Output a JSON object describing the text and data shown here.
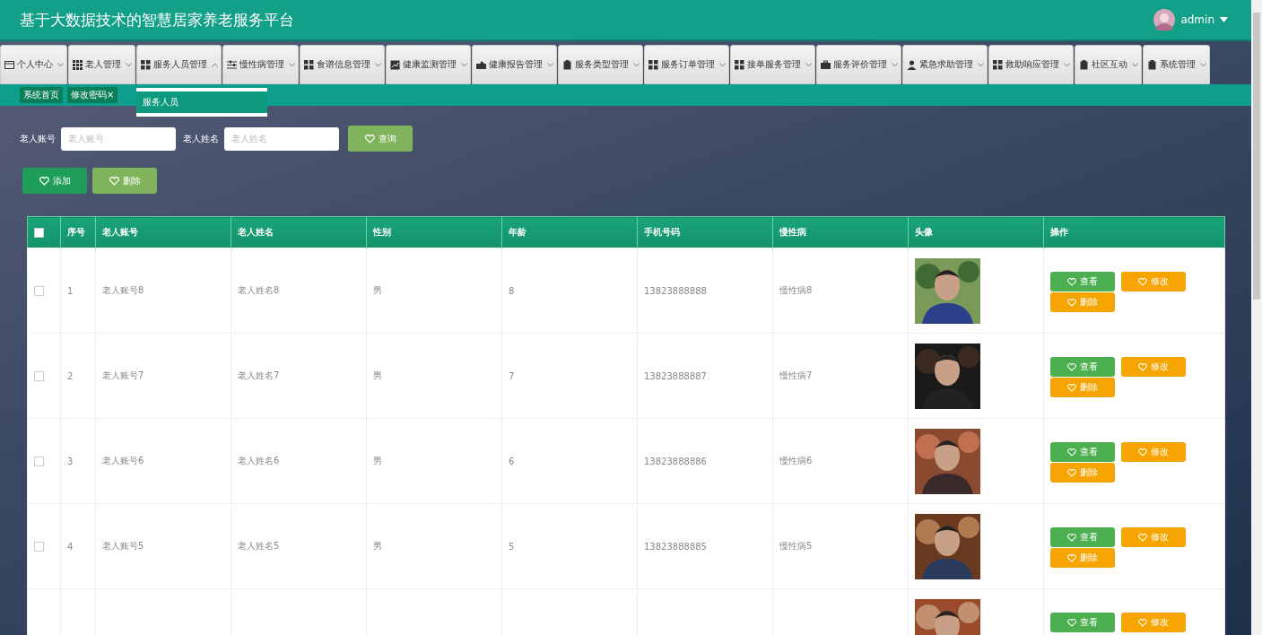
{
  "header": {
    "title": "基于大数据技术的智慧居家养老服务平台",
    "user": "admin"
  },
  "nav": [
    {
      "label": "个人中心",
      "expanded": false
    },
    {
      "label": "老人管理",
      "expanded": false
    },
    {
      "label": "服务人员管理",
      "expanded": true,
      "menu": [
        {
          "label": "服务人员",
          "selected": true
        }
      ]
    },
    {
      "label": "慢性病管理",
      "expanded": false
    },
    {
      "label": "食谱信息管理",
      "expanded": false
    },
    {
      "label": "健康监测管理",
      "expanded": false
    },
    {
      "label": "健康报告管理",
      "expanded": false
    },
    {
      "label": "服务类型管理",
      "expanded": false
    },
    {
      "label": "服务订单管理",
      "expanded": false
    },
    {
      "label": "接单服务管理",
      "expanded": false
    },
    {
      "label": "服务评价管理",
      "expanded": false
    },
    {
      "label": "紧急求助管理",
      "expanded": false
    },
    {
      "label": "救助响应管理",
      "expanded": false
    },
    {
      "label": "社区互动",
      "expanded": false
    },
    {
      "label": "系统管理",
      "expanded": false
    }
  ],
  "page_tabs": [
    {
      "label": "系统首页"
    },
    {
      "label": "修改密码",
      "close": "×"
    }
  ],
  "search": {
    "fields": [
      {
        "label": "老人账号",
        "placeholder": "老人账号"
      },
      {
        "label": "老人姓名",
        "placeholder": "老人姓名"
      }
    ],
    "button": "查询"
  },
  "actions": [
    {
      "label": "添加",
      "kind": "add"
    },
    {
      "label": "删除",
      "kind": "delete"
    }
  ],
  "table": {
    "all_checked": false,
    "columns": [
      "序号",
      "老人账号",
      "老人姓名",
      "性别",
      "年龄",
      "手机号码",
      "慢性病",
      "头像",
      "操作"
    ],
    "rows": [
      {
        "checked": false,
        "cells": [
          "1",
          "老人账号8",
          "老人姓名8",
          "男",
          "8",
          "13823888888",
          "慢性病8"
        ],
        "buttons": [
          {
            "label": "查看",
            "kind": "view"
          },
          {
            "label": "修改",
            "kind": "edit"
          },
          {
            "label": "删除",
            "kind": "delete"
          }
        ]
      },
      {
        "checked": false,
        "cells": [
          "2",
          "老人账号7",
          "老人姓名7",
          "男",
          "7",
          "13823888887",
          "慢性病7"
        ],
        "buttons": [
          {
            "label": "查看",
            "kind": "view"
          },
          {
            "label": "修改",
            "kind": "edit"
          },
          {
            "label": "删除",
            "kind": "delete"
          }
        ]
      },
      {
        "checked": false,
        "cells": [
          "3",
          "老人账号6",
          "老人姓名6",
          "男",
          "6",
          "13823888886",
          "慢性病6"
        ],
        "buttons": [
          {
            "label": "查看",
            "kind": "view"
          },
          {
            "label": "修改",
            "kind": "edit"
          },
          {
            "label": "删除",
            "kind": "delete"
          }
        ]
      },
      {
        "checked": false,
        "cells": [
          "4",
          "老人账号5",
          "老人姓名5",
          "男",
          "5",
          "13823888885",
          "慢性病5"
        ],
        "buttons": [
          {
            "label": "查看",
            "kind": "view"
          },
          {
            "label": "修改",
            "kind": "edit"
          },
          {
            "label": "删除",
            "kind": "delete"
          }
        ]
      },
      {
        "cells": [],
        "buttons": [
          {
            "label": "查看",
            "kind": "view"
          },
          {
            "label": "修改",
            "kind": "edit"
          }
        ]
      }
    ]
  }
}
